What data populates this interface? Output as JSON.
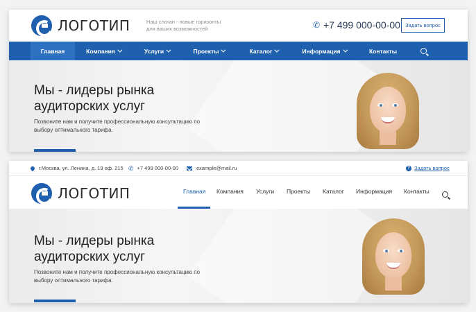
{
  "brand": {
    "logo_text": "ЛОГОТИП",
    "slogan_line1": "Наш слоган - новые горизонты",
    "slogan_line2": "для ваших возможностей",
    "accent_color": "#1e5fae"
  },
  "header1": {
    "phone": "+7 499 000-00-00",
    "ask_button": "Задать вопрос"
  },
  "nav1": {
    "items": [
      {
        "label": "Главная"
      },
      {
        "label": "Компания"
      },
      {
        "label": "Услуги"
      },
      {
        "label": "Проекты"
      },
      {
        "label": "Каталог"
      },
      {
        "label": "Информация"
      },
      {
        "label": "Контакты"
      }
    ]
  },
  "hero": {
    "title_line1": "Мы - лидеры рынка",
    "title_line2": "аудиторских услуг",
    "subtitle_line1": "Позвоните нам и получите профессиональную консультацию по",
    "subtitle_line2": "выбору оптимального тарифа."
  },
  "topbar2": {
    "address": "г.Москва, ул. Ленина, д. 19 оф. 215",
    "phone": "+7 499 000-00-00",
    "email": "example@mail.ru",
    "ask_link": "Задать вопрос"
  },
  "nav2": {
    "items": [
      {
        "label": "Главная"
      },
      {
        "label": "Компания"
      },
      {
        "label": "Услуги"
      },
      {
        "label": "Проекты"
      },
      {
        "label": "Каталог"
      },
      {
        "label": "Информация"
      },
      {
        "label": "Контакты"
      }
    ]
  }
}
